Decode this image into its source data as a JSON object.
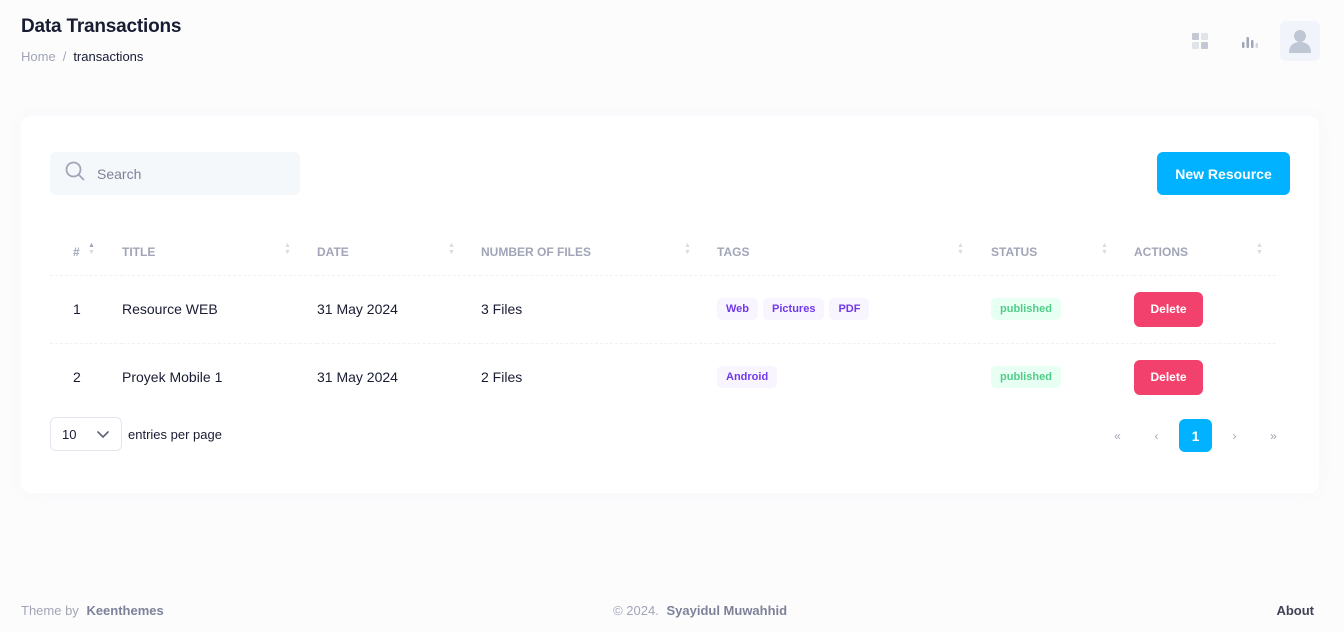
{
  "header": {
    "title": "Data Transactions",
    "breadcrumb": {
      "home": "Home",
      "separator": "/",
      "current": "transactions"
    }
  },
  "toolbar": {
    "search_placeholder": "Search",
    "new_button": "New Resource"
  },
  "table": {
    "columns": [
      "#",
      "TITLE",
      "DATE",
      "NUMBER OF FILES",
      "TAGS",
      "STATUS",
      "ACTIONS"
    ],
    "rows": [
      {
        "num": "1",
        "title": "Resource WEB",
        "date": "31 May 2024",
        "files": "3 Files",
        "tags": [
          "Web",
          "Pictures",
          "PDF"
        ],
        "status": "published",
        "action": "Delete"
      },
      {
        "num": "2",
        "title": "Proyek Mobile 1",
        "date": "31 May 2024",
        "files": "2 Files",
        "tags": [
          "Android"
        ],
        "status": "published",
        "action": "Delete"
      }
    ]
  },
  "pagination": {
    "per_page_value": "10",
    "per_page_label": "entries per page",
    "first": "«",
    "prev": "‹",
    "current": "1",
    "next": "›",
    "last": "»"
  },
  "footer": {
    "theme_by": "Theme by",
    "theme_name": "Keenthemes",
    "copyright": "© 2024.",
    "author": "Syayidul Muwahhid",
    "about": "About"
  },
  "colors": {
    "primary": "#00b2ff",
    "danger": "#f1416c",
    "success": "#50cd89",
    "tag": "#7239ea"
  }
}
